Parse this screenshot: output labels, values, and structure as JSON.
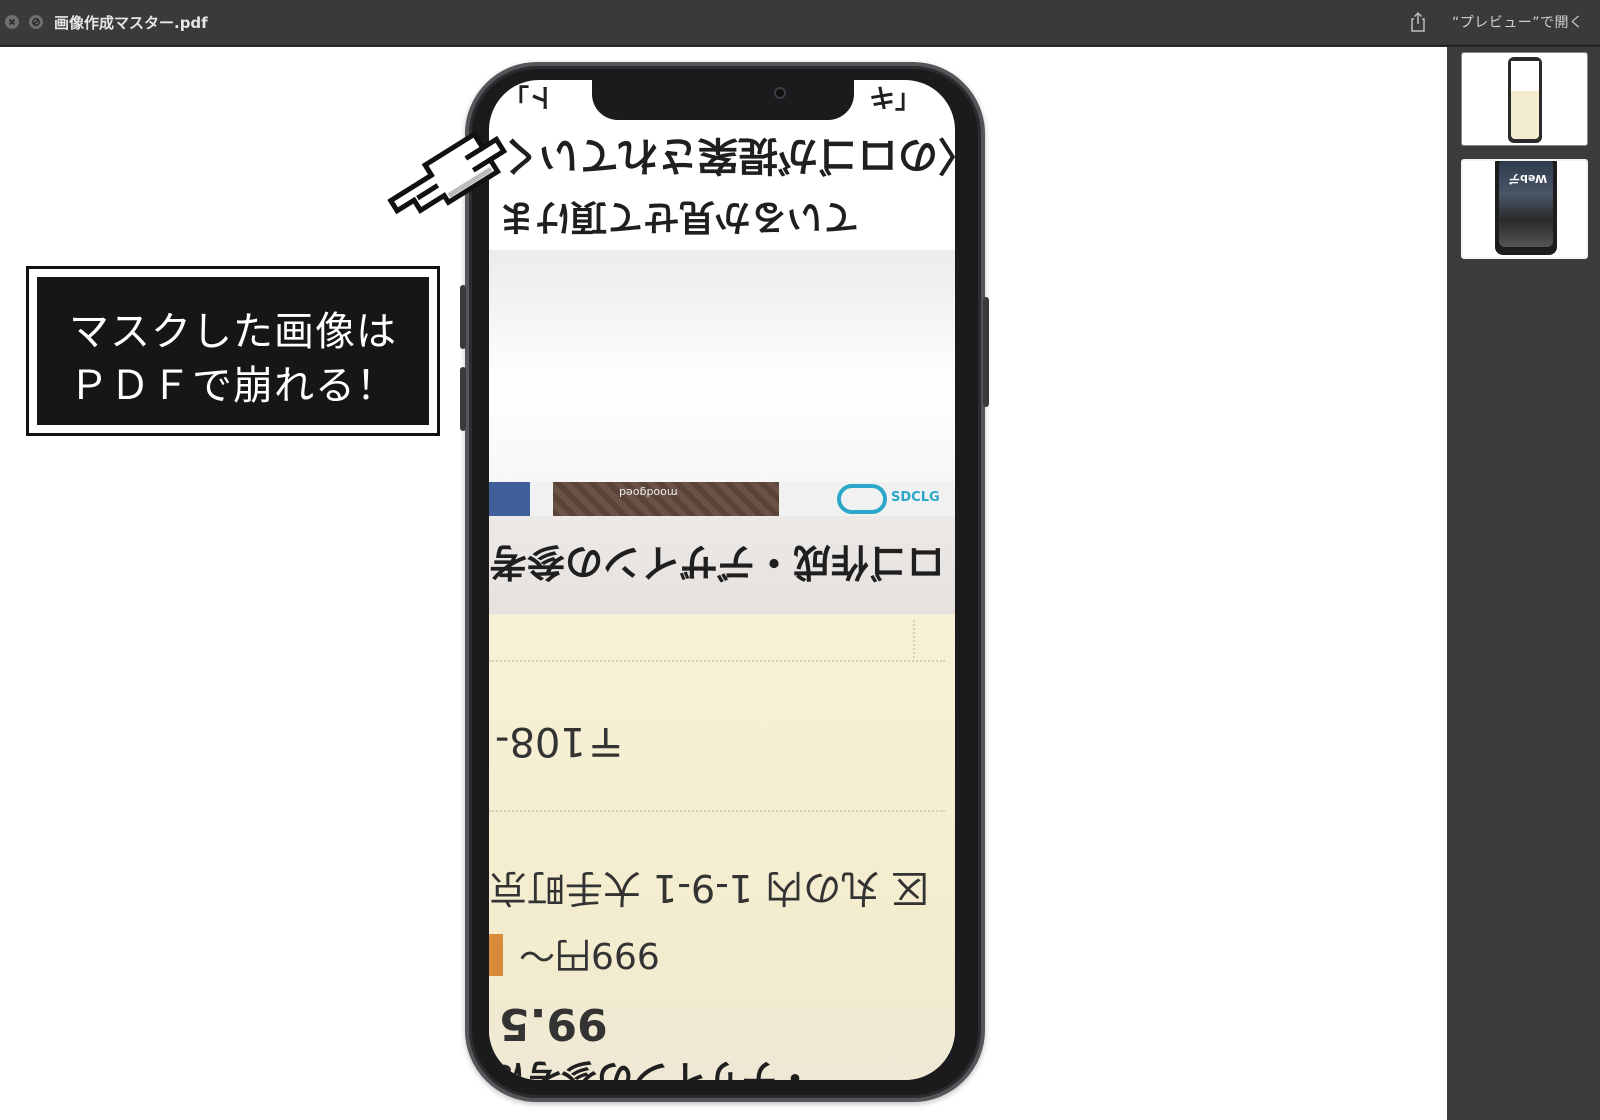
{
  "window": {
    "title": "画像作成マスター.pdf",
    "open_in_preview": "“プレビュー”で開く"
  },
  "icons": {
    "close": "close-icon",
    "minimize": "minimize-icon",
    "share": "share-icon",
    "pointer": "pointing-hand-icon"
  },
  "callout": {
    "line1": "マスクした画像は",
    "line2": "ＰＤＦで崩れる！"
  },
  "screen_text": {
    "corner_left": "ト」",
    "corner_right": "「キ",
    "top_line1": "〈のロゴが提案されていく",
    "top_line2": "ているか見せて頂けま",
    "logo_brown": "moodgoed",
    "logo_brand": "SDCLG",
    "heading": "ロゴ作成・デザインの参考",
    "zip": "〒108-",
    "address": "区 丸の内 1-9-1 大手町京",
    "price": "999円～",
    "rating": "99.5",
    "bottom": "・デザインの参考に"
  },
  "thumbnails": {
    "second_label": "Webデ"
  },
  "colors": {
    "titlebar": "#3a3a3a",
    "sidebar": "#3b3b3b",
    "callout_bg": "#161616",
    "card_bg": "#f3ecce",
    "price_tag": "#d8893a",
    "logo_cyan": "#2aa7c9"
  }
}
